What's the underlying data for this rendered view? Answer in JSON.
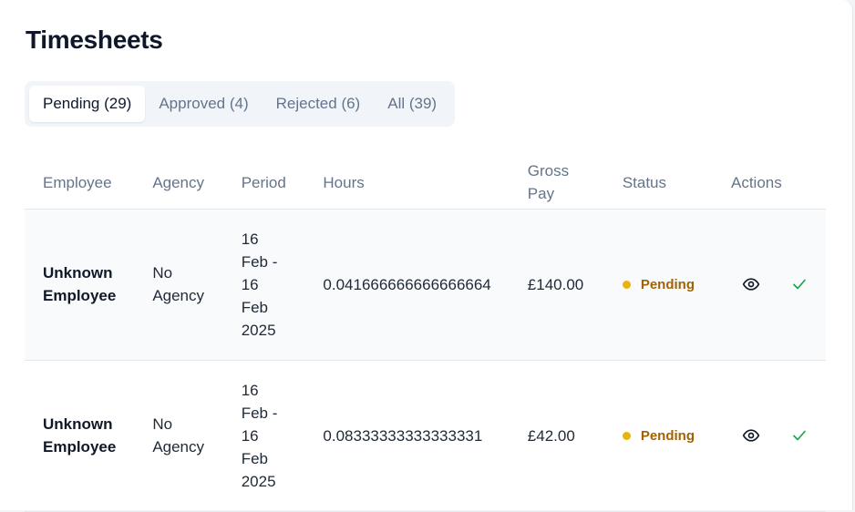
{
  "page": {
    "title": "Timesheets"
  },
  "tabs": [
    {
      "label": "Pending (29)",
      "active": true
    },
    {
      "label": "Approved (4)",
      "active": false
    },
    {
      "label": "Rejected (6)",
      "active": false
    },
    {
      "label": "All (39)",
      "active": false
    }
  ],
  "table": {
    "headers": {
      "employee": "Employee",
      "agency": "Agency",
      "period": "Period",
      "hours": "Hours",
      "gross_pay": "Gross Pay",
      "status": "Status",
      "actions": "Actions"
    },
    "rows": [
      {
        "employee": "Unknown Employee",
        "agency": "No Agency",
        "period": "16 Feb - 16 Feb 2025",
        "hours": "0.041666666666666664",
        "gross_pay": "£140.00",
        "status": "Pending",
        "actions": [
          "eye-icon",
          "check-icon"
        ]
      },
      {
        "employee": "Unknown Employee",
        "agency": "No Agency",
        "period": "16 Feb - 16 Feb 2025",
        "hours": "0.08333333333333331",
        "gross_pay": "£42.00",
        "status": "Pending",
        "actions": [
          "eye-icon",
          "check-icon"
        ]
      }
    ]
  },
  "colors": {
    "pending_dot": "#eab308",
    "pending_text": "#a16207",
    "approve_check": "#16a34a",
    "muted_text": "#64748b"
  }
}
